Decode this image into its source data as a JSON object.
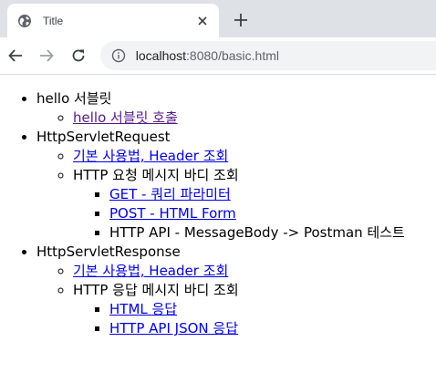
{
  "browser": {
    "tab_title": "Title",
    "url_host": "localhost",
    "url_rest": ":8080/basic.html"
  },
  "page": {
    "sections": [
      {
        "label": "hello 서블릿",
        "items": [
          {
            "text": "hello 서블릿 호출",
            "link": true,
            "visited": true
          }
        ]
      },
      {
        "label": "HttpServletRequest",
        "items": [
          {
            "text": "기본 사용법, Header 조회",
            "link": true
          },
          {
            "text": "HTTP 요청 메시지 바디 조회",
            "link": false,
            "children": [
              {
                "text": "GET - 쿼리 파라미터",
                "link": true
              },
              {
                "text": "POST - HTML Form",
                "link": true
              },
              {
                "text": "HTTP API - MessageBody -> Postman 테스트",
                "link": false
              }
            ]
          }
        ]
      },
      {
        "label": "HttpServletResponse",
        "items": [
          {
            "text": "기본 사용법, Header 조회",
            "link": true
          },
          {
            "text": "HTTP 응답 메시지 바디 조회",
            "link": false,
            "children": [
              {
                "text": "HTML 응답",
                "link": true
              },
              {
                "text": "HTTP API JSON 응답",
                "link": true
              }
            ]
          }
        ]
      }
    ]
  }
}
